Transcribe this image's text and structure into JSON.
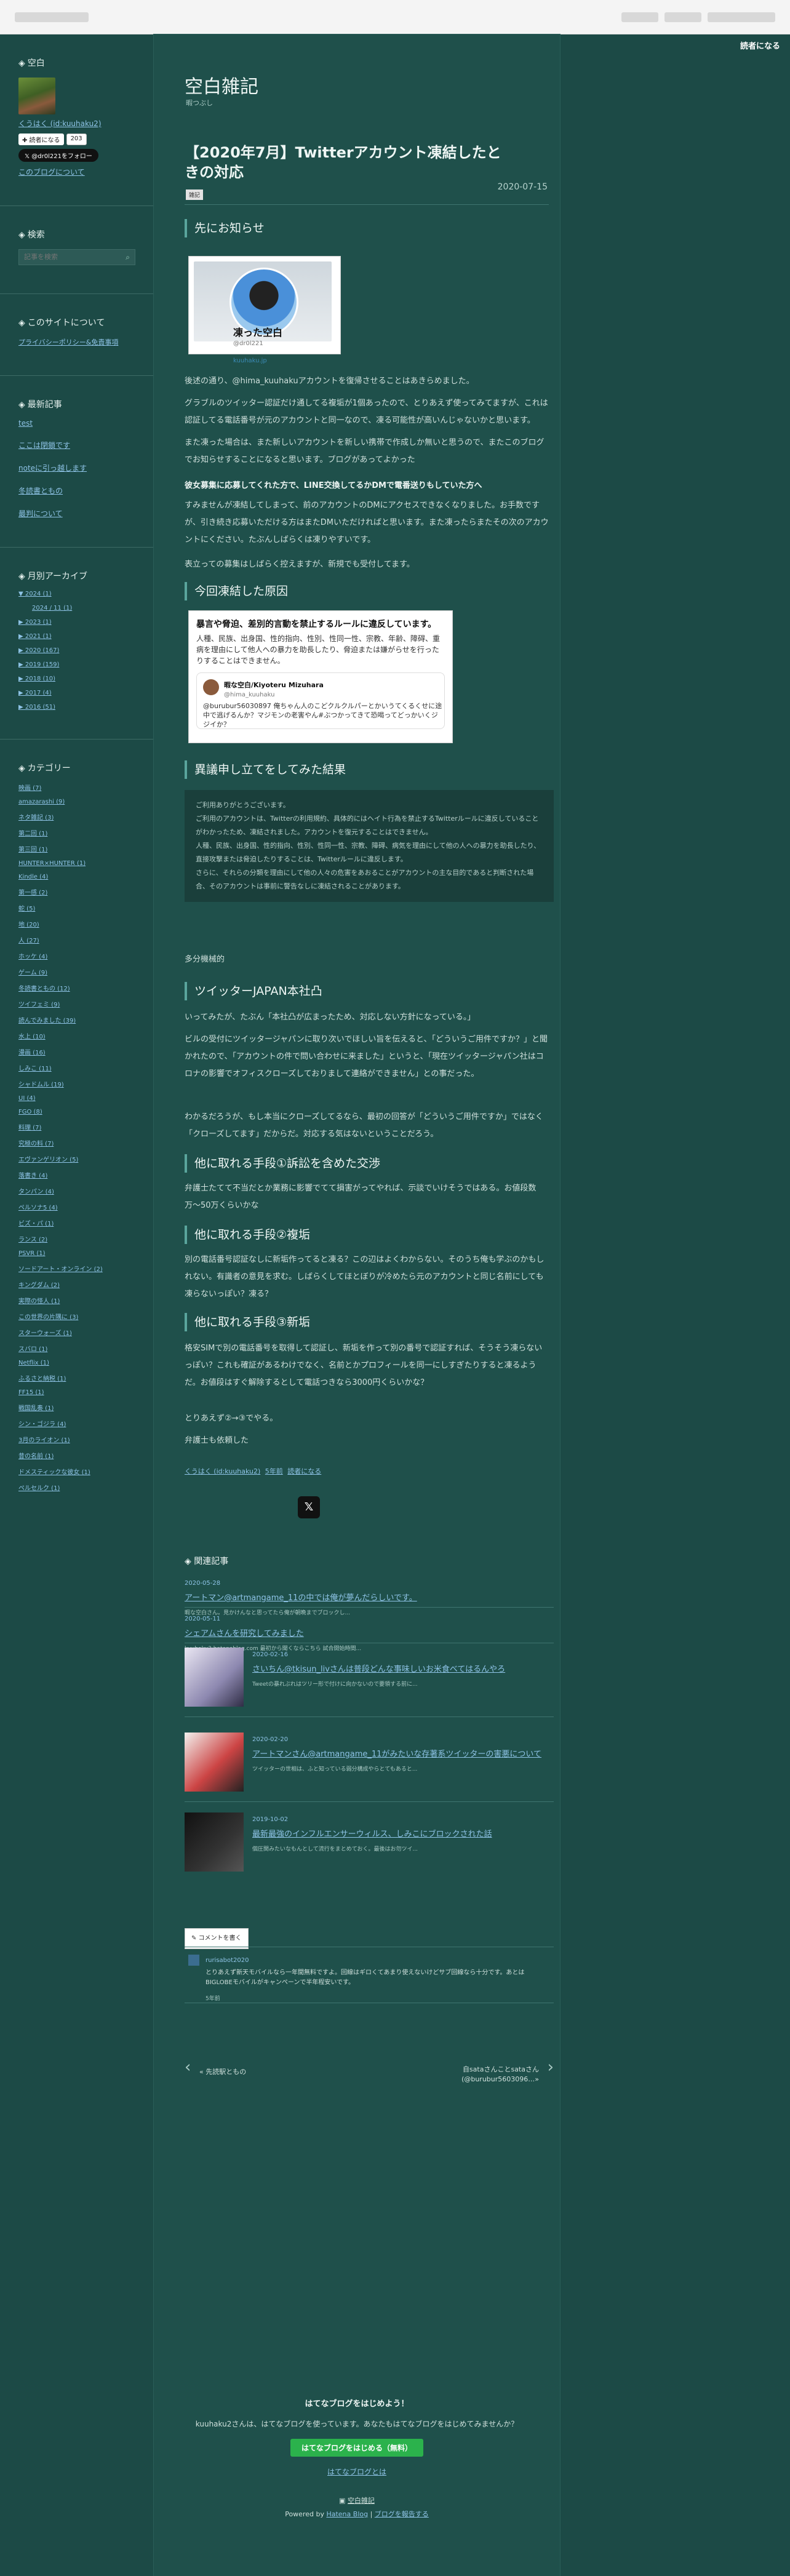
{
  "reader_button": "読者になる",
  "sidebar": {
    "profile": {
      "title": "空白",
      "name": "くうはく (id:kuuhaku2)",
      "bookmark": "✚ 読者になる",
      "count": "203",
      "x_follow": "@dr0l221をフォロー",
      "about_link": "このブログについて"
    },
    "search": {
      "title": "検索",
      "placeholder": "記事を検索"
    },
    "site": {
      "title": "このサイトについて",
      "link": "プライバシーポリシー&免責事項"
    },
    "recent": {
      "title": "最新記事",
      "items": [
        "test",
        "ここは閉鎖です",
        "noteに引っ越します",
        "冬読書ともの",
        "最判について"
      ]
    },
    "archive": {
      "title": "月別アーカイブ",
      "items": [
        {
          "label": "▼ 2024 (1)",
          "sub": false
        },
        {
          "label": "2024 / 11 (1)",
          "sub": true
        },
        {
          "label": "▶ 2023 (1)",
          "sub": false
        },
        {
          "label": "▶ 2021 (1)",
          "sub": false
        },
        {
          "label": "▶ 2020 (167)",
          "sub": false
        },
        {
          "label": "▶ 2019 (159)",
          "sub": false
        },
        {
          "label": "▶ 2018 (10)",
          "sub": false
        },
        {
          "label": "▶ 2017 (4)",
          "sub": false
        },
        {
          "label": "▶ 2016 (51)",
          "sub": false
        }
      ]
    },
    "categories": {
      "title": "カテゴリー",
      "items": [
        "映画 (7)",
        "amazarashi (9)",
        "ネタ雑記 (3)",
        "第二回 (1)",
        "第三回 (1)",
        "HUNTER×HUNTER (1)",
        "Kindle (4)",
        "第一感 (2)",
        "蛇 (5)",
        "地 (20)",
        "人 (27)",
        "ホッケ (4)",
        "ゲーム (9)",
        "冬読書ともの (12)",
        "ツイフェミ (9)",
        "読んでみました (39)",
        "水上 (10)",
        "漫画 (16)",
        "しみこ (11)",
        "シャドムル (19)",
        "UI (4)",
        "FGO (8)",
        "料理 (7)",
        "究極の料 (7)",
        "エヴァンゲリオン (5)",
        "落書き (4)",
        "タンパン (4)",
        "ペルソナ5 (4)",
        "ビズ・パ (1)",
        "ランス (2)",
        "PSVR (1)",
        "ソードアート・オンライン (2)",
        "キングダム (2)",
        "実際の怪人 (1)",
        "この世界の片隅に (3)",
        "スターウォーズ (1)",
        "スバロ (1)",
        "Netflix (1)",
        "ふるさと納税 (1)",
        "FF15 (1)",
        "戦国乱奏 (1)",
        "シン・ゴジラ (4)",
        "3月のライオン (1)",
        "昔の名前 (1)",
        "ドメスティックな彼女 (1)",
        "ペルセルク (1)"
      ]
    }
  },
  "main": {
    "blog_title": "空白雑記",
    "blog_sub": "暇つぶし",
    "post_title": "【2020年7月】Twitterアカウント凍結したときの対応",
    "category": "雑記",
    "date": "2020-07-15",
    "sections": {
      "h_notice": "先にお知らせ",
      "card_profile": {
        "name": "凍った空白",
        "id": "@dr0l221",
        "link": "kuuhaku.jp"
      },
      "p1": "後述の通り、@hima_kuuhakuアカウントを復帰させることはあきらめました。",
      "p2": "グラブルのツイッター認証だけ通してる複垢が1個あったので、とりあえず使ってみてますが、これは認証してる電話番号が元のアカウントと同一なので、凍る可能性が高いんじゃないかと思います。",
      "p3": "また凍った場合は、また新しいアカウントを新しい携帯で作成しか無いと思うので、またこのブログでお知らせすることになると思います。ブログがあってよかった",
      "p4": "彼女募集に応募してくれた方で、LINE交換してるかDMで電番送りもしていた方へ",
      "p5": "すみませんが凍結してしまって、前のアカウントのDMにアクセスできなくなりました。お手数ですが、引き続き応募いただける方はまたDMいただければと思います。また凍ったらまたその次のアカウントにください。たぶんしばらくは凍りやすいです。",
      "p6": "表立っての募集はしばらく控えますが、新規でも受付してます。",
      "h_cause": "今回凍結した原因",
      "card_rule": {
        "title_pre": "暴言や脅迫、",
        "title_b1": "暴言や脅迫",
        "title_b2": "差別的言動",
        "title": "暴言や脅迫、差別的言動を禁止するルールに違反しています。",
        "desc": "人種、民族、出身国、性的指向、性別、性同一性、宗教、年齢、障碍、重病を理由にして他人への暴力を助長したり、脅迫または嫌がらせを行ったりすることはできません。",
        "tw_name": "暇な空白/Kiyoteru Mizuhara",
        "tw_user": "@hima_kuuhaku",
        "tw_msg": "@burubur56030897 俺ちゃん人のこどクルクルパーとかいうてくるくせに途中で逃げるんか？マジモンの老害やん#ぶつかってきて恐喝ってどっかいくジジイか？"
      },
      "h_appeal": "異議申し立てをしてみた結果",
      "quote": [
        "ご利用ありがとうございます。",
        "ご利用のアカウントは、Twitterの利用規約、具体的にはヘイト行為を禁止するTwitterルールに違反していることがわかったため、凍結されました。アカウントを復元することはできません。",
        "人種、民族、出身国、性的指向、性別、性同一性、宗教、障碍、病気を理由にして他の人への暴力を助長したり、直接攻撃または脅迫したりすることは、Twitterルールに違反します。",
        "さらに、それらの分類を理由にして他の人々の危害をあおることがアカウントの主な目的であると判断された場合、そのアカウントは事前に警告なしに凍結されることがあります。"
      ],
      "p7": "多分機械的",
      "h_japan": "ツイッターJAPAN本社凸",
      "p8": "いってみたが、たぶん「本社凸が広まったため、対応しない方針になっている。」",
      "p9": "ビルの受付にツイッタージャパンに取り次いでほしい旨を伝えると、「どういうご用件ですか？」と聞かれたので、「アカウントの件で問い合わせに来ました」というと、「現在ツイッタージャパン社はコロナの影響でオフィスクローズしておりまして連絡ができません」との事だった。",
      "p10": "わかるだろうが、もし本当にクローズしてるなら、最初の回答が「どういうご用件ですか」ではなく「クローズしてます」だからだ。対応する気はないということだろう。",
      "h_lawsuit": "他に取れる手段①訴訟を含めた交渉",
      "p11": "弁護士たてて不当だとか業務に影響でてて損害がってやれば、示談でいけそうではある。お値段数万〜50万くらいかな",
      "h_fake": "他に取れる手段②複垢",
      "p12": "別の電話番号認証なしに新垢作ってると凍る？この辺はよくわからない。そのうち俺も学ぶのかもしれない。有識者の意見を求む。しばらくしてほとぼりが冷めたら元のアカウントと同じ名前にしても凍らないっぽい？凍る？",
      "h_new": "他に取れる手段③新垢",
      "p13": "格安SIMで別の電話番号を取得して認証し、新垢を作って別の番号で認証すれば、そうそう凍らないっぽい？これも確証があるわけでなく、名前とかプロフィールを同一にしすぎたりすると凍るようだ。お値段はすぐ解除するとして電話つきなら3000円くらいかな？",
      "p14": "とりあえず②→③でやる。",
      "p15": "弁護士も依頼した",
      "byline_user": "くうはく (id:kuuhaku2)",
      "byline_time": "5年前",
      "byline_reader": "読者になる"
    },
    "related": {
      "title": "関連記事",
      "items": [
        {
          "date": "2020-05-28",
          "title": "アートマン@artmangame_11の中では俺が夢んだらしいです。",
          "ex": "暇な空白さん。見かけんなと思ってたら俺が朝晩までブロックし..."
        },
        {
          "date": "2020-05-11",
          "title": "シェアムさんを研究してみました",
          "ex": "kuuhaku2.hatenablog.com 最初から聞くならこちら 試合開始時間..."
        },
        {
          "date": "2020-02-16",
          "title": "さいちん@tkisun_livさんは普段どんな事味しいお米食べてはるんやろ",
          "ex": "Tweetの暴れぶれはツリー形で付けに向かないので要領する前に..."
        },
        {
          "date": "2020-02-20",
          "title": "アートマンさん@artmangame_11がみたいな存著系ツイッターの害悪について",
          "ex": "ツイッターの世相は、ふと知っている弱分構成やらとてもあると..."
        },
        {
          "date": "2019-10-02",
          "title": "最新最強のインフルエンサーウィルス、しみこにブロックされた話",
          "ex": "個圧関みたいなもんとして流行をまとめておく。最後はお勿ツイ..."
        }
      ]
    },
    "comment": {
      "button": "コメントを書く",
      "user": "rurisabot2020",
      "msg": "とりあえず新天モバイルなら一年間無料ですよ。回線はギロくてあまり使えないけどサブ回線なら十分です。あとはBIGLOBEモバイルがキャンペーンで半年程安いです。",
      "time": "5年前"
    },
    "pager": {
      "prev": "« 先読駅ともの",
      "next": "自sataさんことsataさん",
      "next2": "(@burubur5603096…»"
    },
    "footer": {
      "head": "はてなブログをはじめよう！",
      "sub": "kuuhaku2さんは、はてなブログを使っています。あなたもはてなブログをはじめてみませんか？",
      "button": "はてなブログをはじめる（無料）",
      "link": "はてなブログとは",
      "brand": "空白雑記",
      "powered": "Powered by",
      "powered_link": "Hatena Blog",
      "report": "ブログを報告する"
    }
  }
}
